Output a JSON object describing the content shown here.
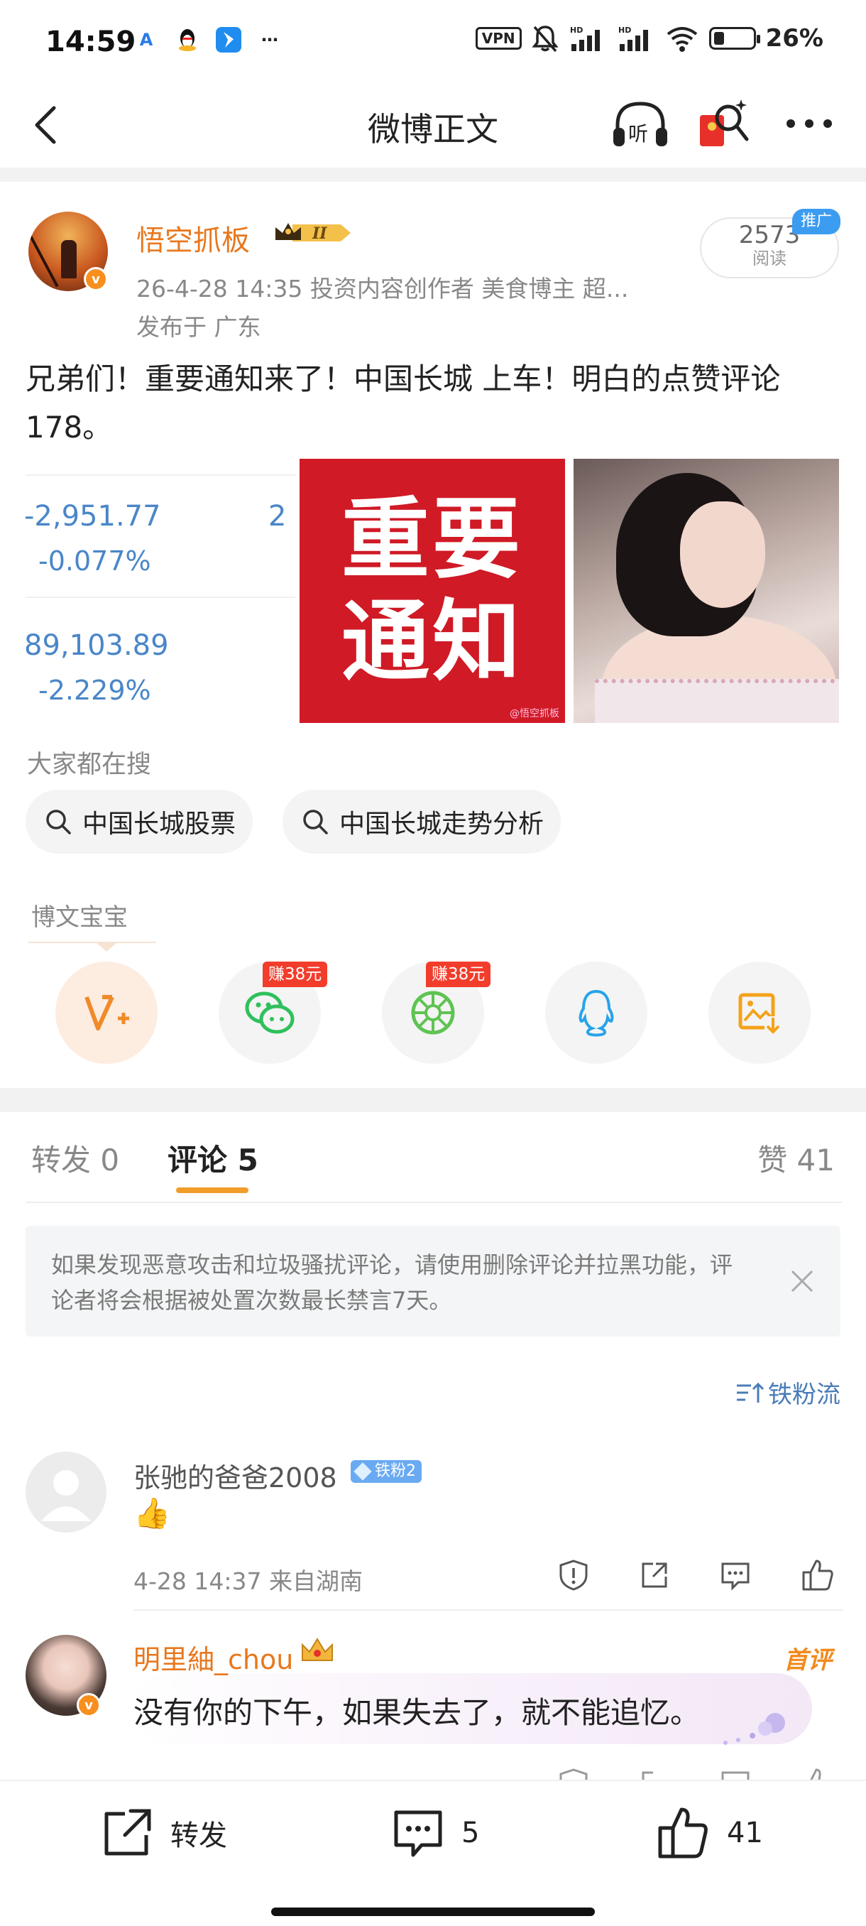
{
  "status_bar": {
    "time": "14:59",
    "app_icons": [
      "app-a-icon",
      "qq-penguin-icon",
      "bluebird-app-icon",
      "more-dots-icon"
    ],
    "vpn": "VPN",
    "battery_pct": "26%",
    "battery_level": 0.26
  },
  "nav": {
    "title": "微博正文",
    "listen_label": "听"
  },
  "post": {
    "author": "悟空抓板",
    "badge_level": "II",
    "meta": "26-4-28 14:35   投资内容创作者 美食博主 超...",
    "location": "发布于 广东",
    "views_count": "2573",
    "views_label": "阅读",
    "promo_tag": "推广",
    "text": "兄弟们！重要通知来了！中国长城 上车！明白的点赞评论178。",
    "stocks": [
      {
        "value": "-2,951.77",
        "change": "-0.077%",
        "partial": "2"
      },
      {
        "value": "89,103.89",
        "change": "-2.229%"
      }
    ],
    "image1_text_line1": "重要",
    "image1_text_line2": "通知",
    "image1_watermark": "@悟空抓板"
  },
  "search": {
    "title": "大家都在搜",
    "chips": [
      "中国长城股票",
      "中国长城走势分析"
    ]
  },
  "share": {
    "title": "博文宝宝",
    "earn_tag_wechat": "赚38元",
    "earn_tag_moments": "赚38元",
    "icons": [
      "vplus-icon",
      "wechat-icon",
      "moments-icon",
      "qq-icon",
      "save-image-icon"
    ]
  },
  "comments_section": {
    "tab_repost": "转发 0",
    "tab_comment": "评论 5",
    "tab_likes": "赞 41",
    "notice": "如果发现恶意攻击和垃圾骚扰评论，请使用删除评论并拉黑功能，评论者将会根据被处置次数最长禁言7天。",
    "sort_label": "铁粉流",
    "items": [
      {
        "name": "张驰的爸爸2008",
        "badge": "铁粉2",
        "text": "👍",
        "meta": "4-28 14:37  来自湖南"
      },
      {
        "name": "明里紬_chou",
        "first_tag": "首评",
        "text": "没有你的下午，如果失去了，就不能追忆。"
      }
    ]
  },
  "bottom_bar": {
    "repost_label": "转发",
    "comment_count": "5",
    "like_count": "41"
  },
  "colors": {
    "brand_orange": "#e8781e",
    "stock_blue": "#4a86c8",
    "tab_underline": "#f29d2a",
    "earn_red": "#f23d2c",
    "notice_red": "#d01a26"
  }
}
